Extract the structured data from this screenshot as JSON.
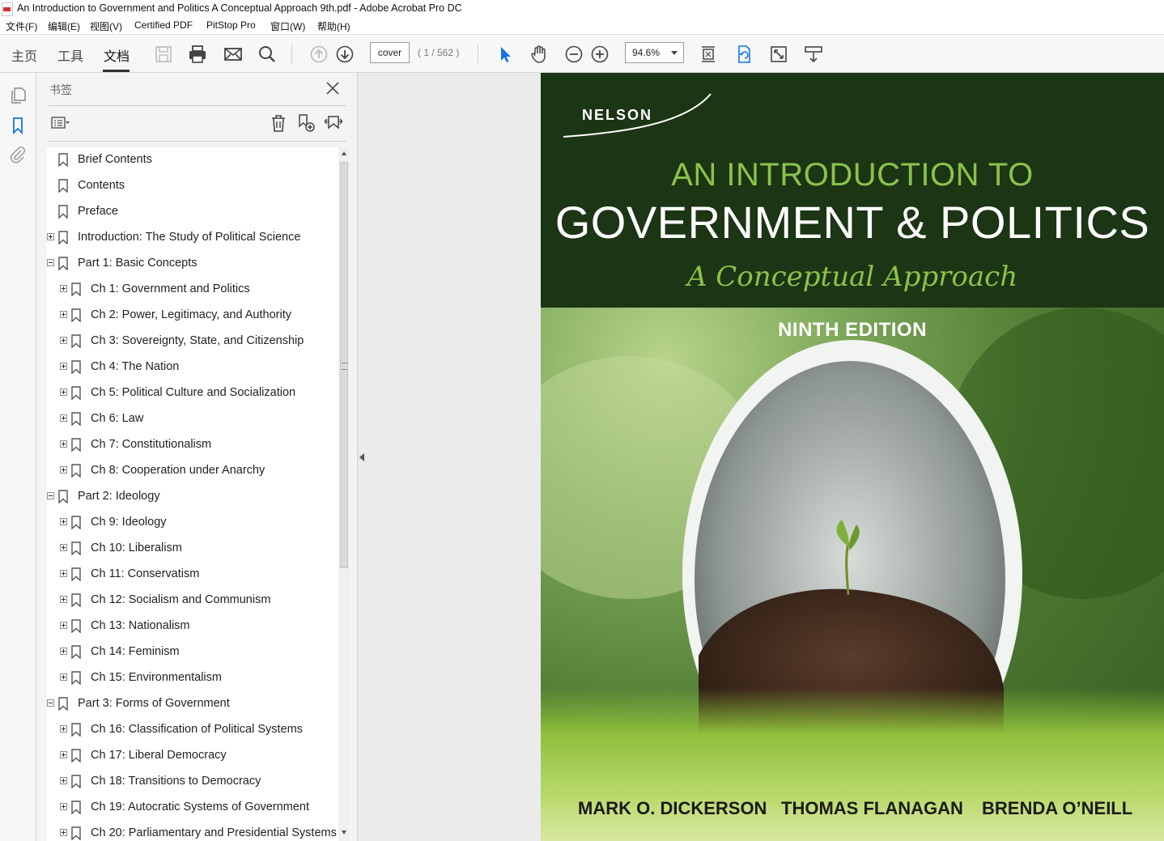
{
  "window": {
    "title": "An Introduction to Government and Politics A Conceptual Approach 9th.pdf - Adobe Acrobat Pro DC"
  },
  "menu": [
    "文件(F)",
    "编辑(E)",
    "视图(V)",
    "Certified PDF",
    "PitStop Pro",
    "窗口(W)",
    "帮助(H)"
  ],
  "toolbar": {
    "tabs": [
      "主页",
      "工具",
      "文档"
    ],
    "active_tab": "文档",
    "page_field": "cover",
    "page_count": "( 1 / 562 )",
    "zoom": "94.6%",
    "icons": [
      "save-icon",
      "print-icon",
      "email-icon",
      "search-icon",
      "page-up-icon",
      "page-down-icon",
      "select-arrow-icon",
      "hand-icon",
      "zoom-out-icon",
      "zoom-in-icon",
      "fit-page-icon",
      "rotate-icon",
      "fullscreen-icon",
      "read-mode-icon"
    ]
  },
  "bookmarks": {
    "title": "书签",
    "items": [
      {
        "label": "Brief Contents",
        "level": 0,
        "toggle": "none"
      },
      {
        "label": "Contents",
        "level": 0,
        "toggle": "none"
      },
      {
        "label": "Preface",
        "level": 0,
        "toggle": "none"
      },
      {
        "label": "Introduction: The Study of Political Science",
        "level": 0,
        "toggle": "plus"
      },
      {
        "label": "Part 1: Basic Concepts",
        "level": 0,
        "toggle": "minus"
      },
      {
        "label": "Ch 1: Government and Politics",
        "level": 1,
        "toggle": "plus"
      },
      {
        "label": "Ch 2: Power, Legitimacy, and Authority",
        "level": 1,
        "toggle": "plus"
      },
      {
        "label": "Ch 3:  Sovereignty, State, and Citizenship",
        "level": 1,
        "toggle": "plus"
      },
      {
        "label": "Ch 4: The Nation",
        "level": 1,
        "toggle": "plus"
      },
      {
        "label": "Ch 5: Political Culture and Socialization",
        "level": 1,
        "toggle": "plus"
      },
      {
        "label": "Ch 6: Law",
        "level": 1,
        "toggle": "plus"
      },
      {
        "label": "Ch 7: Constitutionalism",
        "level": 1,
        "toggle": "plus"
      },
      {
        "label": "Ch 8: Cooperation under Anarchy",
        "level": 1,
        "toggle": "plus"
      },
      {
        "label": "Part 2: Ideology",
        "level": 0,
        "toggle": "minus"
      },
      {
        "label": "Ch 9: Ideology",
        "level": 1,
        "toggle": "plus"
      },
      {
        "label": "Ch 10: Liberalism",
        "level": 1,
        "toggle": "plus"
      },
      {
        "label": "Ch 11: Conservatism",
        "level": 1,
        "toggle": "plus"
      },
      {
        "label": "Ch 12: Socialism and Communism",
        "level": 1,
        "toggle": "plus"
      },
      {
        "label": "Ch 13: Nationalism",
        "level": 1,
        "toggle": "plus"
      },
      {
        "label": "Ch 14: Feminism",
        "level": 1,
        "toggle": "plus"
      },
      {
        "label": "Ch 15: Environmentalism",
        "level": 1,
        "toggle": "plus"
      },
      {
        "label": "Part 3: Forms of Government",
        "level": 0,
        "toggle": "minus"
      },
      {
        "label": "Ch 16: Classification of Political Systems",
        "level": 1,
        "toggle": "plus"
      },
      {
        "label": "Ch 17: Liberal Democracy",
        "level": 1,
        "toggle": "plus"
      },
      {
        "label": "Ch 18: Transitions to Democracy",
        "level": 1,
        "toggle": "plus"
      },
      {
        "label": "Ch 19: Autocratic Systems of Government",
        "level": 1,
        "toggle": "plus"
      },
      {
        "label": "Ch 20: Parliamentary and Presidential Systems",
        "level": 1,
        "toggle": "plus"
      }
    ]
  },
  "cover": {
    "publisher": "NELSON",
    "title_line1": "AN INTRODUCTION TO",
    "title_line2": "GOVERNMENT & POLITICS",
    "subtitle": "A Conceptual Approach",
    "edition": "NINTH EDITION",
    "authors": [
      "MARK O. DICKERSON",
      "THOMAS FLANAGAN",
      "BRENDA O’NEILL"
    ],
    "colors": {
      "top_band": "#1c3515",
      "accent_green": "#8bc34a"
    }
  }
}
